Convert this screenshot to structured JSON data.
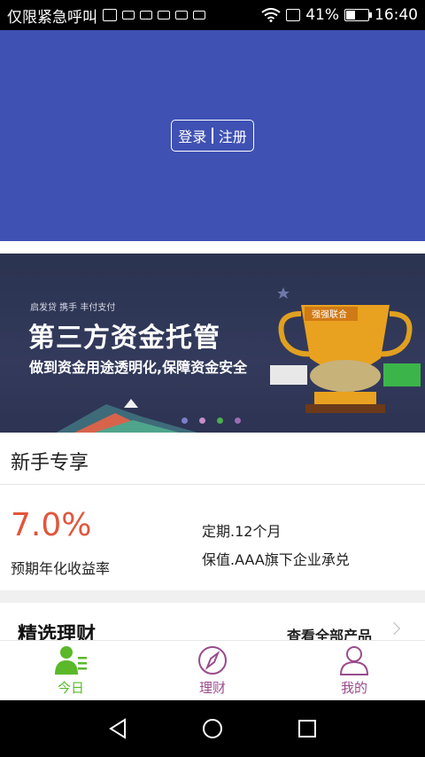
{
  "status_bar": {
    "carrier": "仅限紧急呼叫",
    "battery_percent": "41%",
    "battery_level": 0.41,
    "time": "16:40",
    "icons": [
      "sim-icon",
      "keyboard-icon",
      "notification-icon",
      "notification-icon",
      "notification-icon",
      "notification-icon",
      "wifi-icon",
      "sim-card-icon",
      "battery-icon"
    ]
  },
  "header": {
    "login_label": "登录",
    "register_label": "注册"
  },
  "banner": {
    "tags": "启发贷 携手 丰付支付",
    "title": "第三方资金托管",
    "subtitle": "做到资金用途透明化,保障资金安全",
    "trophy_text": "强强联合",
    "page_count": 4,
    "active_page": 1,
    "dot_colors": [
      "#7a7ec9",
      "#c48ec9",
      "#4caf50",
      "#9b6bb5"
    ]
  },
  "newbie": {
    "title": "新手专享",
    "rate": "7.0%",
    "rate_label": "预期年化收益率",
    "term": "定期.12个月",
    "guarantee": "保值.AAA旗下企业承兑"
  },
  "selected": {
    "title": "精选理财",
    "view_all": "查看全部产品"
  },
  "tabbar": {
    "tabs": [
      {
        "label": "今日",
        "icon": "person-list-icon",
        "active": true
      },
      {
        "label": "理财",
        "icon": "compass-icon",
        "active": false
      },
      {
        "label": "我的",
        "icon": "user-icon",
        "active": false
      }
    ],
    "active_color": "#5ab82a",
    "inactive_color": "#9a4b8c"
  },
  "navbar": {
    "icons": [
      "back-icon",
      "home-icon",
      "recents-icon"
    ]
  },
  "colors": {
    "header_bg": "#3f51b3",
    "rate_color": "#e0563c"
  }
}
